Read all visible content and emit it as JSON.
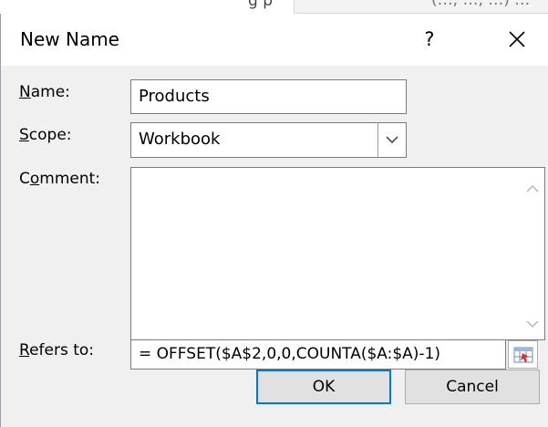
{
  "background": {
    "fragment_left": "g p",
    "fragment_right": "(…, …, …) …"
  },
  "dialog": {
    "title": "New Name",
    "help_label": "?",
    "close_icon": "close-icon"
  },
  "form": {
    "name_label_first": "N",
    "name_label_rest": "ame:",
    "name_value": "Products",
    "scope_label_first": "S",
    "scope_label_rest": "cope:",
    "scope_value": "Workbook",
    "comment_label_pre": "C",
    "comment_label_mid": "o",
    "comment_label_rest": "mment:",
    "comment_value": "",
    "refers_label_first": "R",
    "refers_label_rest": "efers to:",
    "refers_value": "= OFFSET($A$2,0,0,COUNTA($A:$A)-1)"
  },
  "buttons": {
    "ok": "OK",
    "cancel": "Cancel"
  },
  "colors": {
    "dialog_bg": "#f0f0f0",
    "titlebar_bg": "#ffffff",
    "ok_border": "#0078d7",
    "button_bg": "#e1e1e1"
  }
}
